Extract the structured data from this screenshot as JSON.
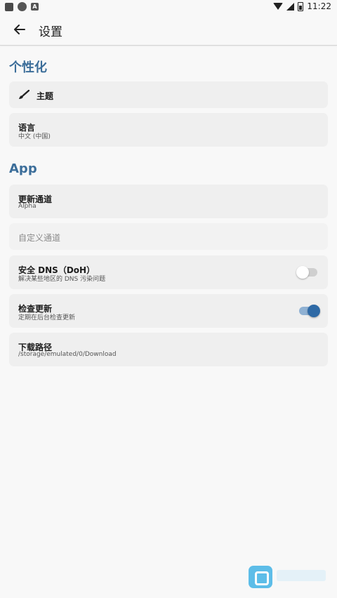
{
  "status_bar": {
    "time": "11:22",
    "left_icons": [
      "notification-icon",
      "vpn-icon",
      "a-icon"
    ],
    "right_icons": [
      "wifi-icon",
      "signal-icon",
      "battery-icon"
    ]
  },
  "app_bar": {
    "back_icon": "arrow-left-icon",
    "title": "设置"
  },
  "sections": {
    "personalization": {
      "title": "个性化"
    },
    "app": {
      "title": "App"
    }
  },
  "settings": {
    "theme": {
      "label": "主题",
      "icon": "brush-icon"
    },
    "language": {
      "label": "语言",
      "value": "中文 (中国)"
    },
    "update_channel": {
      "label": "更新通道",
      "value": "Alpha"
    },
    "custom_channel": {
      "placeholder": "自定义通道"
    },
    "secure_dns": {
      "label": "安全 DNS（DoH）",
      "description": "解决某些地区的 DNS 污染问题",
      "enabled": false
    },
    "check_updates": {
      "label": "检查更新",
      "description": "定期在后台检查更新",
      "enabled": true
    },
    "download_path": {
      "label": "下载路径",
      "value": "/storage/emulated/0/Download"
    }
  },
  "colors": {
    "accent": "#3c6e9a",
    "toggle_on": "#2f6aa6",
    "card_bg": "#efefef",
    "page_bg": "#f8f8f8"
  }
}
